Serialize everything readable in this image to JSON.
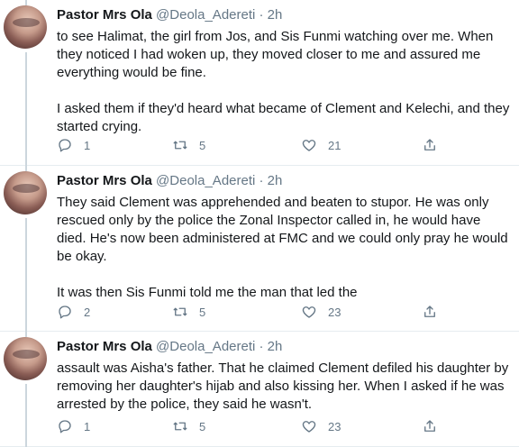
{
  "tweets": [
    {
      "name": "Pastor Mrs Ola",
      "handle": "@Deola_Adereti · 2h",
      "paragraphs": [
        "to see Halimat, the girl from Jos, and Sis Funmi watching over me. When they noticed I had woken up, they moved closer to me and assured me everything would be fine.",
        "I asked them if they'd heard what became of Clement and Kelechi, and they started crying."
      ],
      "replies": "1",
      "retweets": "5",
      "likes": "21"
    },
    {
      "name": "Pastor Mrs Ola",
      "handle": "@Deola_Adereti · 2h",
      "paragraphs": [
        "They said Clement was apprehended and beaten to stupor. He was only rescued only by the police the Zonal Inspector called in, he would have died. He's now been administered at FMC and we could only pray he would be okay.",
        "It was then Sis Funmi told me the man that led the"
      ],
      "replies": "2",
      "retweets": "5",
      "likes": "23"
    },
    {
      "name": "Pastor Mrs Ola",
      "handle": "@Deola_Adereti · 2h",
      "paragraphs": [
        "assault was Aisha's father. That he claimed Clement defiled his daughter by removing her daughter's hijab and also kissing her. When I asked if he was arrested by the police, they said he wasn't."
      ],
      "replies": "1",
      "retweets": "5",
      "likes": "23"
    }
  ],
  "icons": {
    "reply": "reply-icon",
    "retweet": "retweet-icon",
    "like": "heart-icon",
    "share": "share-icon"
  },
  "colors": {
    "muted": "#657786",
    "divider": "#e6ecf0",
    "thread": "#ccd6dd"
  }
}
